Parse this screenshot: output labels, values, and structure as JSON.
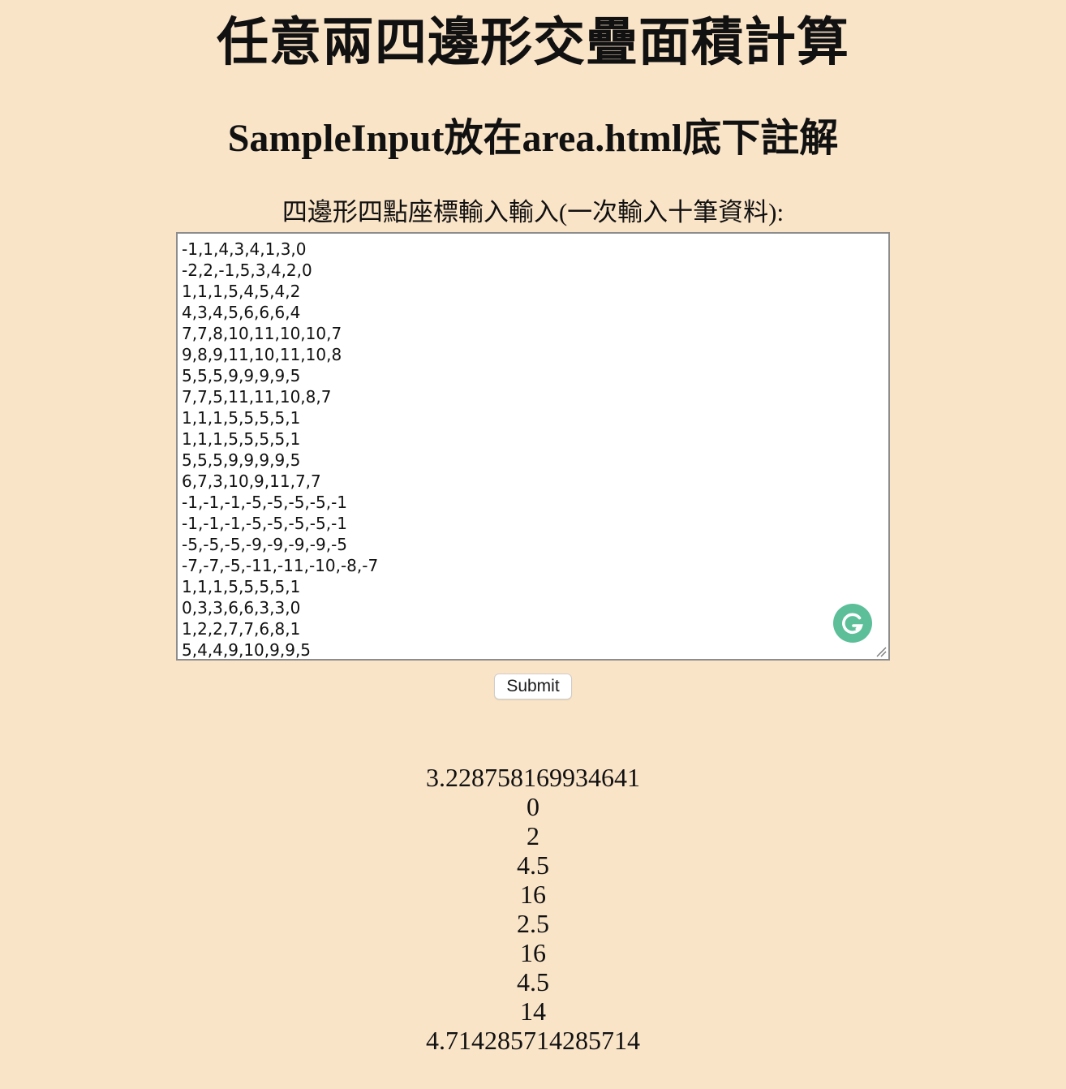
{
  "page": {
    "title": "任意兩四邊形交疊面積計算",
    "subtitle": "SampleInput放在area.html底下註解",
    "input_label": "四邊形四點座標輸入輸入(一次輸入十筆資料):",
    "input_value": "-1,1,4,3,4,1,3,0\n-2,2,-1,5,3,4,2,0\n1,1,1,5,4,5,4,2\n4,3,4,5,6,6,6,4\n7,7,8,10,11,10,10,7\n9,8,9,11,10,11,10,8\n5,5,5,9,9,9,9,5\n7,7,5,11,11,10,8,7\n1,1,1,5,5,5,5,1\n1,1,1,5,5,5,5,1\n5,5,5,9,9,9,9,5\n6,7,3,10,9,11,7,7\n-1,-1,-1,-5,-5,-5,-5,-1\n-1,-1,-1,-5,-5,-5,-5,-1\n-5,-5,-5,-9,-9,-9,-9,-5\n-7,-7,-5,-11,-11,-10,-8,-7\n1,1,1,5,5,5,5,1\n0,3,3,6,6,3,3,0\n1,2,2,7,7,6,8,1\n5,4,4,9,10,9,9,5",
    "submit_label": "Submit",
    "results": [
      "3.228758169934641",
      "0",
      "2",
      "4.5",
      "16",
      "2.5",
      "16",
      "4.5",
      "14",
      "4.714285714285714"
    ]
  },
  "colors": {
    "background": "#fae4c8",
    "grammarly_badge": "#5cbf99"
  },
  "icons": {
    "grammarly": "grammarly-g-icon",
    "resize": "resize-grip-icon"
  }
}
